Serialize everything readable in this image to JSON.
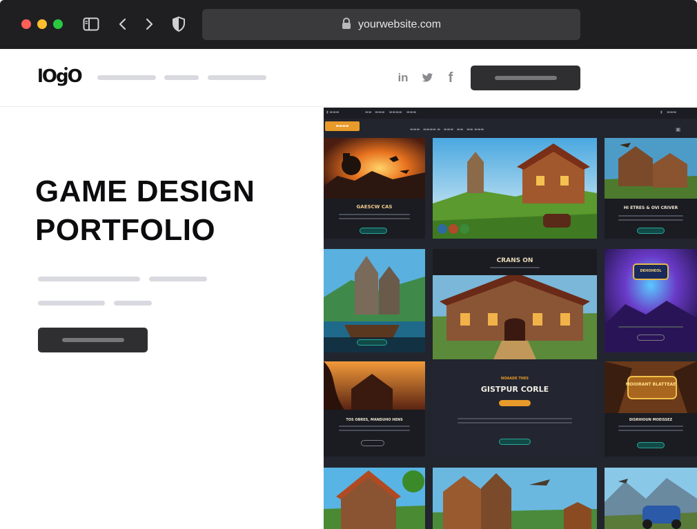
{
  "browser": {
    "address": "yourwebsite.com",
    "icons": [
      "sidebar-icon",
      "back-chevron-icon",
      "forward-chevron-icon",
      "shield-icon",
      "lock-icon"
    ]
  },
  "site": {
    "logo_text": "lOgO",
    "social": {
      "linkedin": "in",
      "twitter": "twitter-bird-icon",
      "facebook": "f"
    }
  },
  "hero": {
    "title_line1": "GAME DESIGN",
    "title_line2": "PORTFOLIO"
  },
  "portfolio": {
    "cards": [
      {
        "label": "GAESCW CAS"
      },
      {
        "label": ""
      },
      {
        "label": "HI ETRES & OVI CRIVER"
      },
      {
        "label": ""
      },
      {
        "label": "CRANS ON"
      },
      {
        "label": "DEHOHEOL"
      },
      {
        "label": "TOS OBRES, MANDUHO HENS"
      },
      {
        "label": "GISTPUR CORLE"
      },
      {
        "label": "DISRHIOUN MOEISSEZ"
      },
      {
        "label": ""
      },
      {
        "label": ""
      },
      {
        "label": ""
      }
    ],
    "featured_kicker": "NOAADE THES",
    "hero_sign": "MOIORANT BLATTEAE"
  },
  "colors": {
    "chrome": "#1f1f21",
    "accent_orange": "#e89a2a",
    "accent_teal": "#2aa59a",
    "button_dark": "#2f2f31"
  }
}
